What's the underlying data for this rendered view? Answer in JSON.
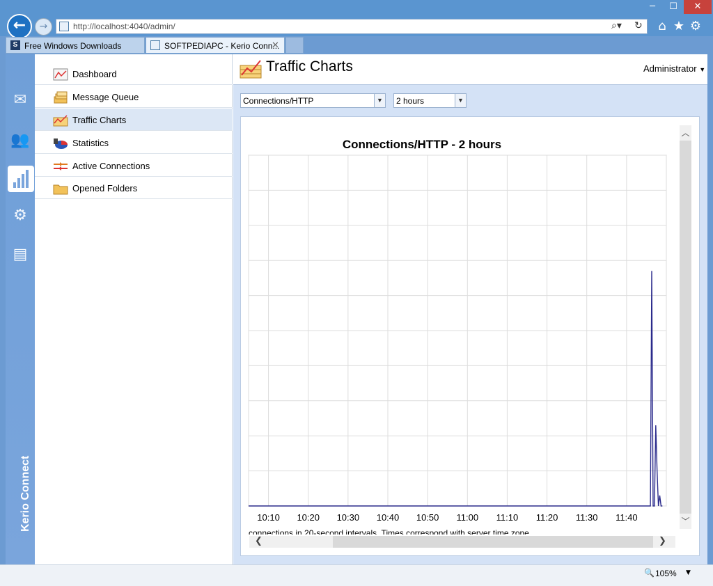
{
  "browser": {
    "address": "http://localhost:4040/admin/",
    "window_buttons": {
      "minimize": "─",
      "maximize": "☐",
      "close": "✕"
    },
    "tabs": [
      {
        "label": "Free Windows Downloads",
        "icon_letter": "S"
      },
      {
        "label": "SOFTPEDIAPC - Kerio Conn...",
        "close": "✕"
      }
    ],
    "zoom": "105%"
  },
  "sidebar": {
    "brand": "Kerio Connect",
    "icons": [
      "mail-icon",
      "users-icon",
      "statistics-icon",
      "settings-icon",
      "documents-icon"
    ]
  },
  "nav": {
    "items": [
      {
        "label": "Dashboard",
        "icon": "dashboard-icon",
        "active": false
      },
      {
        "label": "Message Queue",
        "icon": "message-queue-icon",
        "active": false
      },
      {
        "label": "Traffic Charts",
        "icon": "traffic-charts-icon",
        "active": true
      },
      {
        "label": "Statistics",
        "icon": "statistics-pie-icon",
        "active": false
      },
      {
        "label": "Active Connections",
        "icon": "connections-icon",
        "active": false
      },
      {
        "label": "Opened Folders",
        "icon": "folder-icon",
        "active": false
      }
    ]
  },
  "content": {
    "title": "Traffic Charts",
    "user_menu": "Administrator",
    "metric_select": "Connections/HTTP",
    "range_select": "2 hours"
  },
  "colors": {
    "accent": "#1e71c2",
    "sidebar": "#7aa5dc",
    "series_line": "#2b2b8c",
    "grid": "#dddddd"
  },
  "chart_data": {
    "type": "line",
    "title": "Connections/HTTP - 2 hours",
    "xlabel": "",
    "ylabel": "",
    "caption": "connections in 20-second intervals. Times correspond with server time zone.",
    "x_ticks": [
      "10:10",
      "10:20",
      "10:30",
      "10:40",
      "10:50",
      "11:00",
      "11:10",
      "11:20",
      "11:30",
      "11:40"
    ],
    "x_minutes": [
      0,
      10,
      20,
      30,
      40,
      50,
      60,
      70,
      80,
      90,
      95,
      96,
      97,
      98,
      99,
      100,
      101,
      102,
      103,
      104,
      105
    ],
    "series": [
      {
        "x": [
          "10:05",
          "10:15",
          "10:25",
          "10:35",
          "10:45",
          "10:55",
          "11:05",
          "11:15",
          "11:25",
          "11:35",
          "11:45",
          "11:46",
          "11:46:20",
          "11:46:40",
          "11:47",
          "11:47:20",
          "11:47:40",
          "11:48",
          "11:48:20",
          "11:48:40",
          "11:49"
        ],
        "values": [
          0,
          0,
          0,
          0,
          0,
          0,
          0,
          0,
          0,
          0,
          0,
          0,
          67,
          0,
          0,
          23,
          10,
          0,
          3,
          0,
          0
        ]
      }
    ],
    "ylim": [
      0,
      100
    ],
    "grid": true,
    "legend": "none"
  }
}
